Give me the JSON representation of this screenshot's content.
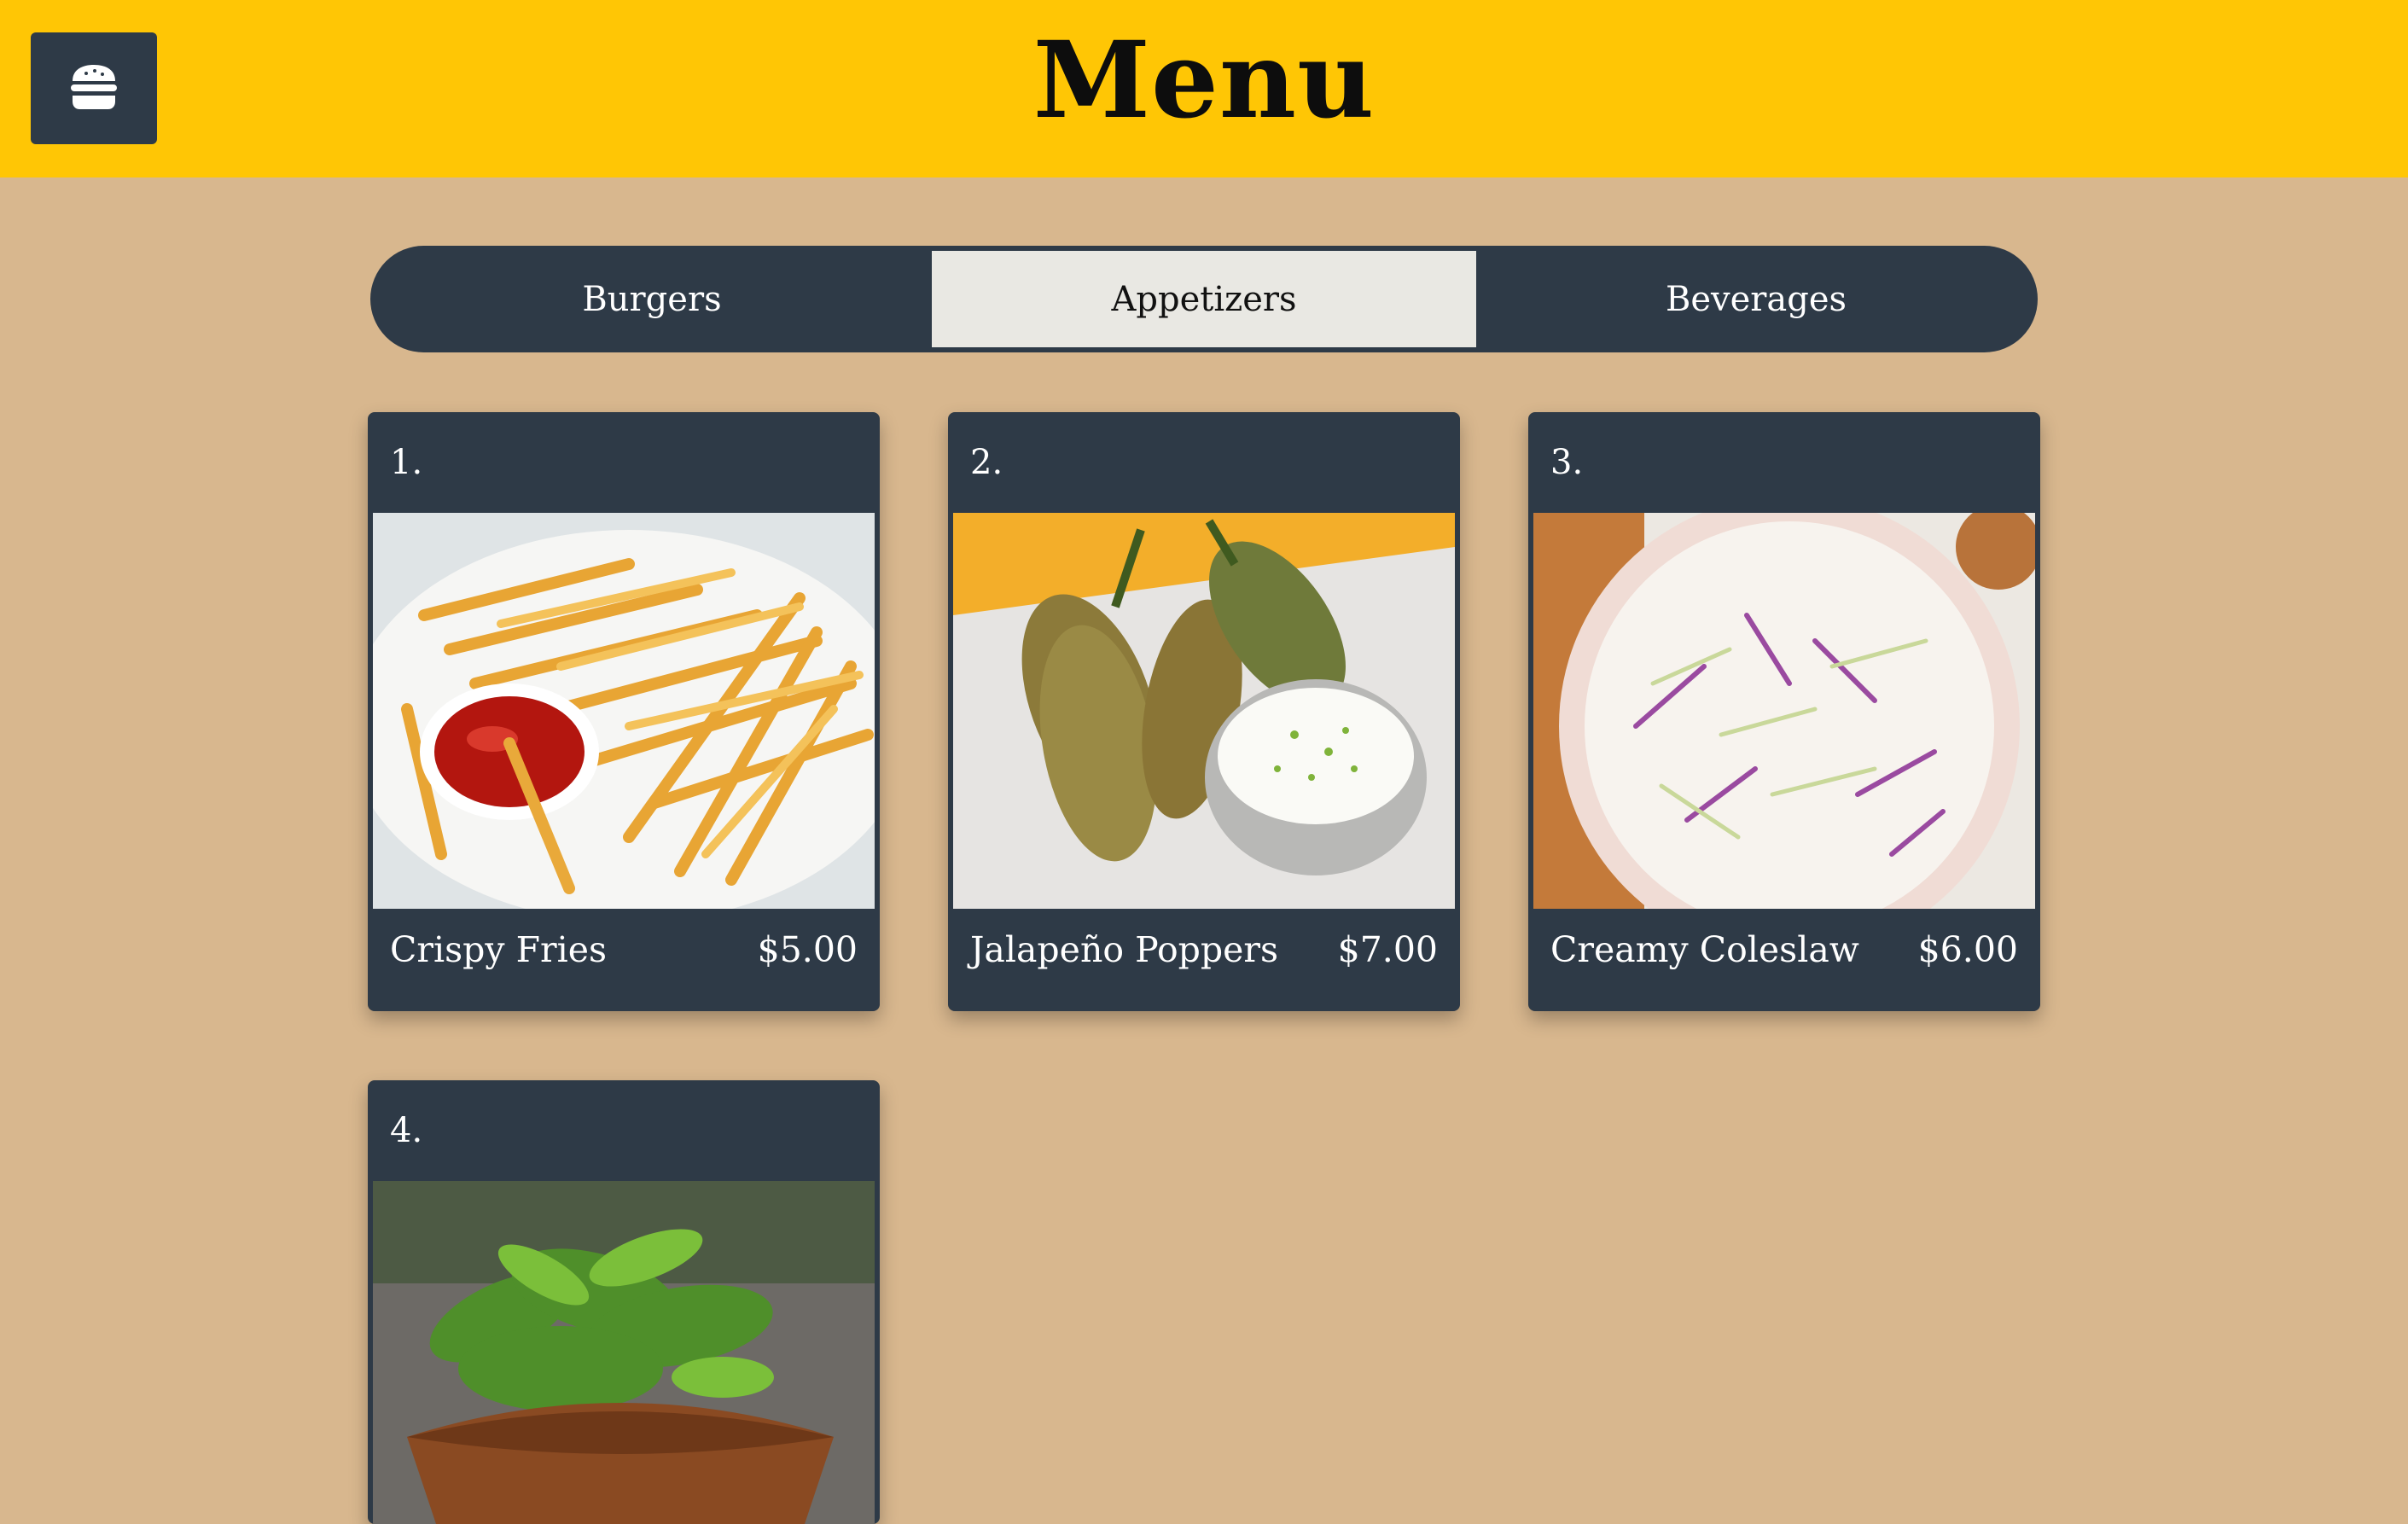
{
  "header": {
    "title": "Menu",
    "menu_button_icon": "burger-icon",
    "background_color": "#ffc605"
  },
  "tabs": [
    {
      "label": "Burgers",
      "active": false
    },
    {
      "label": "Appetizers",
      "active": true
    },
    {
      "label": "Beverages",
      "active": false
    }
  ],
  "items": [
    {
      "number": "1.",
      "name": "Crispy Fries",
      "price": "$5.00"
    },
    {
      "number": "2.",
      "name": "Jalapeño Poppers",
      "price": "$7.00"
    },
    {
      "number": "3.",
      "name": "Creamy Coleslaw",
      "price": "$6.00"
    },
    {
      "number": "4.",
      "name": "",
      "price": ""
    }
  ],
  "colors": {
    "page_background": "#d8b78e",
    "card_background": "#2e3a47",
    "active_tab": "#e9e8e3"
  }
}
